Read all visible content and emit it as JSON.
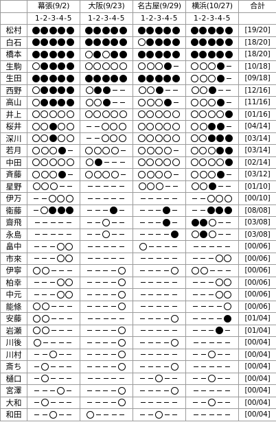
{
  "header": {
    "events": [
      "幕張(9/2)",
      "大阪(9/23)",
      "名古屋(9/29)",
      "横浜(10/27)"
    ],
    "subheader": "1-2-3-4-5",
    "total_label": "合計"
  },
  "legend_symbols": {
    "o": "outline-circle",
    "f": "filled-circle",
    "d": "dash"
  },
  "rows": [
    {
      "name": "松村",
      "e": [
        "fffff",
        "fffff",
        "fffff",
        "fffff"
      ],
      "total": "[19/20]"
    },
    {
      "name": "白石",
      "e": [
        "fffff",
        "fffff",
        "offff",
        "fffff"
      ],
      "total": "[18/20]"
    },
    {
      "name": "橋本",
      "e": [
        "fffff",
        "ofoff",
        "fffff",
        "fffff"
      ],
      "total": "[18/20]"
    },
    {
      "name": "生駒",
      "e": [
        "offff",
        "ooooo",
        "ooofd",
        "ooofd"
      ],
      "total": "[10/18]"
    },
    {
      "name": "生田",
      "e": [
        "fffff",
        "fffff",
        "fffff",
        "ooofd"
      ],
      "total": "[09/18]"
    },
    {
      "name": "西野",
      "e": [
        "offff",
        "offdd",
        "oofdd",
        "oofdd"
      ],
      "total": "[12/16]"
    },
    {
      "name": "高山",
      "e": [
        "offff",
        "oofdd",
        "ooofd",
        "ooofd"
      ],
      "total": "[11/16]"
    },
    {
      "name": "井上",
      "e": [
        "ooooo",
        "ooooo",
        "ooooo",
        "oooof"
      ],
      "total": "[01/16]"
    },
    {
      "name": "桜井",
      "e": [
        "oofoo",
        "ddooo",
        "ooooo",
        "ooftf"
      ],
      "total": "[04/14]"
    },
    {
      "name": "深川",
      "e": [
        "oofoo",
        "ddooo",
        "ooooo",
        "ooff f"
      ],
      "total": "[03/14]"
    },
    {
      "name": "若月",
      "e": [
        "ooofd",
        "oooo d",
        "oooo d",
        "oooffd"
      ],
      "total": "[03/14]"
    },
    {
      "name": "中田",
      "e": [
        "ooooo",
        "ofddd",
        "ooooo",
        "oooof"
      ],
      "total": "[02/14]"
    },
    {
      "name": "斉藤",
      "e": [
        "ooofd",
        "oooo d",
        "oooo d",
        "ooofd"
      ],
      "total": "[03/12]"
    },
    {
      "name": "星野",
      "e": [
        "ooodd",
        "ddddd",
        "ooodd",
        "oofdd"
      ],
      "total": "[01/10]"
    },
    {
      "name": "伊万",
      "e": [
        "ddooo",
        "ddddd",
        "ddddd",
        "ddooo"
      ],
      "total": "[00/10]"
    },
    {
      "name": "衛藤",
      "e": [
        "doff f",
        "dddfd",
        "dddfd",
        "ddff f"
      ],
      "total": "[08/08]"
    },
    {
      "name": "齋飛",
      "e": [
        "ddddd",
        "ddodd",
        "dddfd",
        "ffodd"
      ],
      "total": "[03/08]"
    },
    {
      "name": "永島",
      "e": [
        "ddddd",
        "ddodd",
        "ddddf",
        "ofodd"
      ],
      "total": "[03/08]"
    },
    {
      "name": "畠中",
      "e": [
        "dddoo",
        "ddddd",
        "odddd",
        "ddddd"
      ],
      "total": "[00/06]"
    },
    {
      "name": "市來",
      "e": [
        "dddoo",
        "ddddd",
        "ddddd",
        "dddoo"
      ],
      "total": "[00/06]"
    },
    {
      "name": "伊寧",
      "e": [
        "ooddd",
        "ddddo",
        "ddddo",
        "ooddd"
      ],
      "total": "[00/06]"
    },
    {
      "name": "柏幸",
      "e": [
        "dddoo",
        "ddddo",
        "ddddd",
        "dddoo"
      ],
      "total": "[00/06]"
    },
    {
      "name": "中元",
      "e": [
        "dddoo",
        "ddddo",
        "ddddd",
        "dddoo"
      ],
      "total": "[00/06]"
    },
    {
      "name": "能條",
      "e": [
        "ooddd",
        "ddddo",
        "ddddd",
        "ddddo"
      ],
      "total": "[00/06]"
    },
    {
      "name": "安藤",
      "e": [
        "ooddd",
        "ddddd",
        "ddddo",
        "ddddf"
      ],
      "total": "[01/04]"
    },
    {
      "name": "岩瀬",
      "e": [
        "ooddd",
        "ddddo",
        "ddddd",
        "dddfd"
      ],
      "total": "[01/04]"
    },
    {
      "name": "川後",
      "e": [
        "odddd",
        "ddddo",
        "ddddo",
        "ddddd"
      ],
      "total": "[00/04]"
    },
    {
      "name": "川村",
      "e": [
        "ddodd",
        "ddddo",
        "ddddd",
        "ddodd"
      ],
      "total": "[00/04]"
    },
    {
      "name": "斎ち",
      "e": [
        "dodd d",
        "ddddo",
        "ddddo",
        "ddddd"
      ],
      "total": "[00/04]"
    },
    {
      "name": "樋口",
      "e": [
        "dodd d",
        "ddddd",
        "ddodd",
        "ddodd"
      ],
      "total": "[00/04]"
    },
    {
      "name": "宮澤",
      "e": [
        "dddo d",
        "ddddo",
        "ddddo",
        "ddddd"
      ],
      "total": "[00/04]"
    },
    {
      "name": "大和",
      "e": [
        "dodd d",
        "ddddo",
        "ddddd",
        "ddodd"
      ],
      "total": "[00/04]"
    },
    {
      "name": "和田",
      "e": [
        "ddodd",
        "odddd",
        "ddodd",
        "ddddd"
      ],
      "total": "[00/04]"
    }
  ]
}
